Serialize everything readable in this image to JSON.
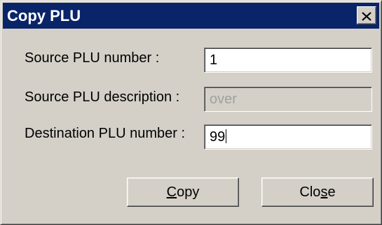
{
  "window": {
    "title": "Copy PLU",
    "close_icon": "close-x-icon",
    "colors": {
      "titlebar": "#0a246a",
      "face": "#d4d0c8"
    }
  },
  "fields": {
    "source_number_label": "Source PLU number :",
    "source_number_value": "1",
    "source_description_label": "Source PLU description :",
    "source_description_value": "over",
    "destination_number_label": "Destination PLU number :",
    "destination_number_value": "99"
  },
  "buttons": {
    "copy_pre": "",
    "copy_mnemonic": "C",
    "copy_post": "opy",
    "close_pre": "Clo",
    "close_mnemonic": "s",
    "close_post": "e"
  }
}
